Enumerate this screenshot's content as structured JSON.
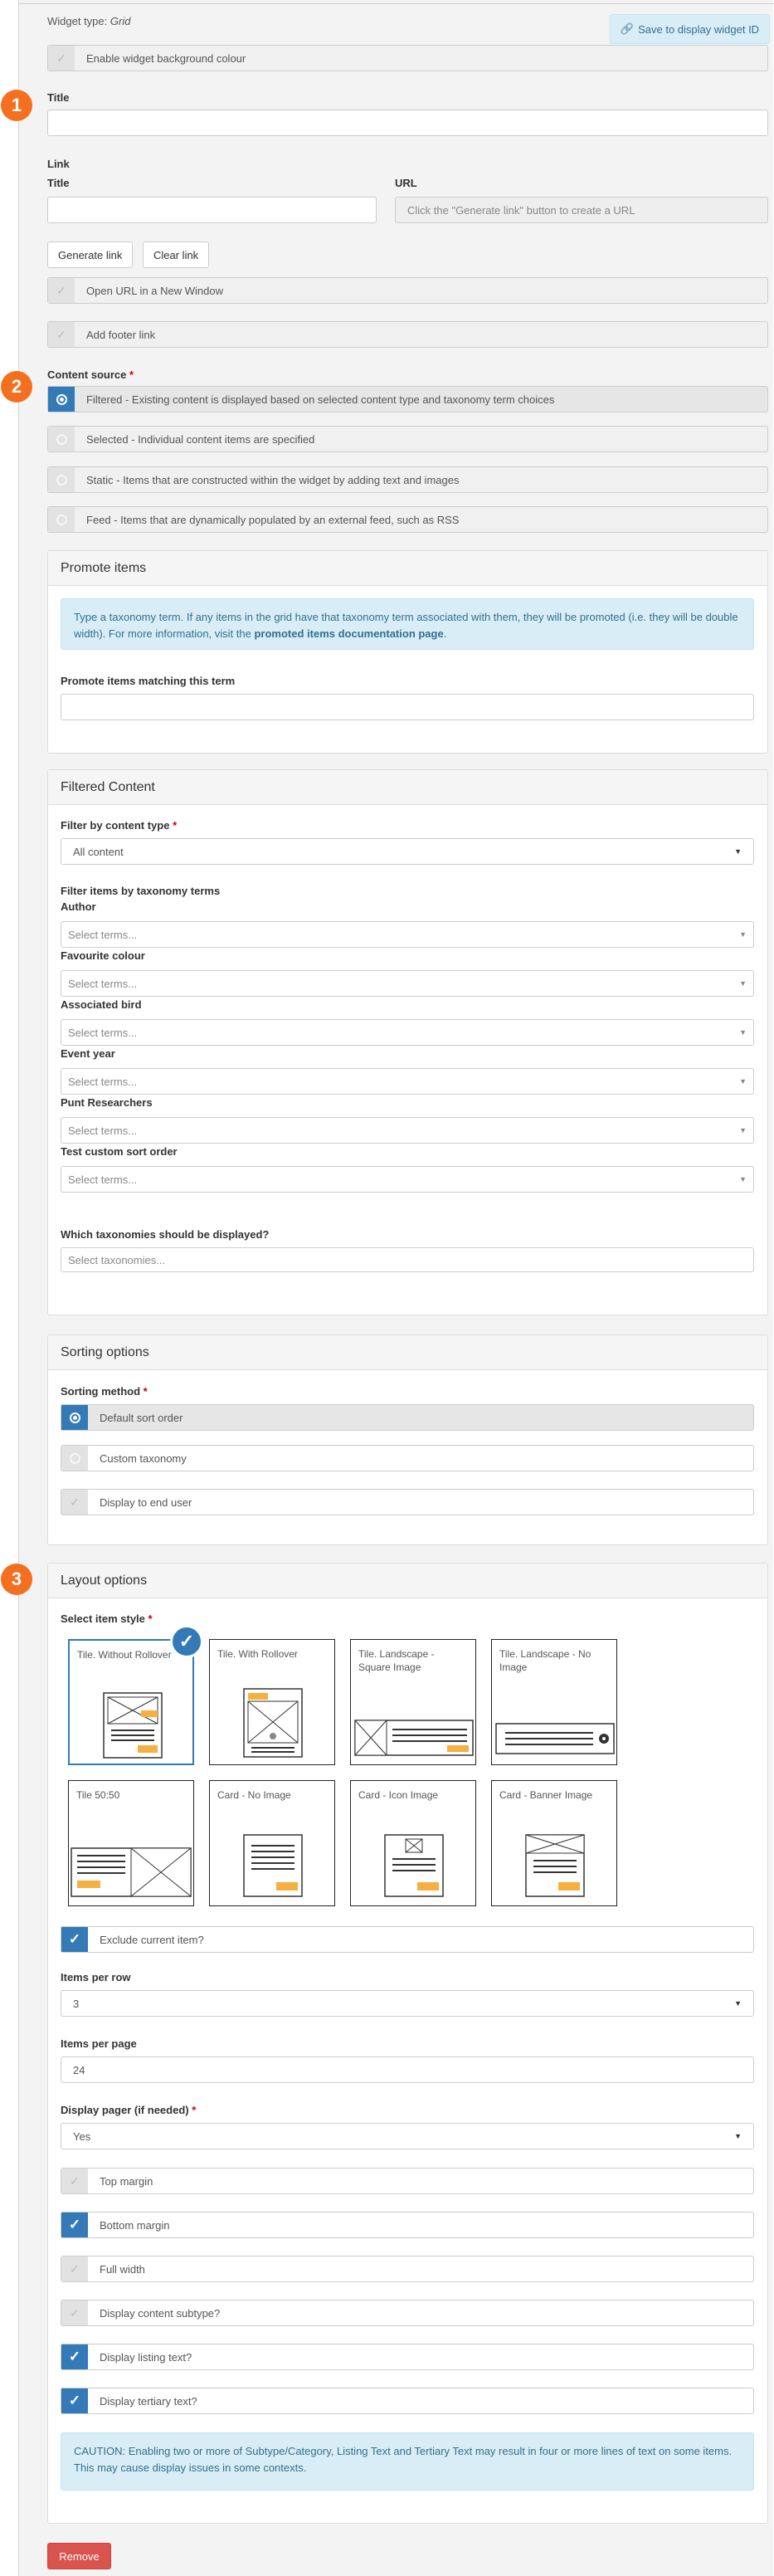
{
  "header": {
    "widget_type_label": "Widget type:",
    "widget_type_value": "Grid",
    "save_button": "Save to display widget ID",
    "enable_bg": "Enable widget background colour"
  },
  "badges": [
    "1",
    "2",
    "3"
  ],
  "title_field": {
    "label": "Title",
    "value": ""
  },
  "link": {
    "section_label": "Link",
    "title_label": "Title",
    "title_value": "",
    "url_label": "URL",
    "url_placeholder": "Click the \"Generate link\" button to create a URL",
    "generate_button": "Generate link",
    "clear_button": "Clear link",
    "open_new_window": "Open URL in a New Window",
    "add_footer_link": "Add footer link"
  },
  "content_source": {
    "label": "Content source",
    "options": [
      "Filtered - Existing content is displayed based on selected content type and taxonomy term choices",
      "Selected - Individual content items are specified",
      "Static - Items that are constructed within the widget by adding text and images",
      "Feed - Items that are dynamically populated by an external feed, such as RSS"
    ]
  },
  "promote": {
    "heading": "Promote items",
    "info_text": "Type a taxonomy term. If any items in the grid have that taxonomy term associated with them, they will be promoted (i.e. they will be double width). For more information, visit the ",
    "info_link": "promoted items documentation page",
    "info_end": ".",
    "field_label": "Promote items matching this term",
    "field_value": ""
  },
  "filtered": {
    "heading": "Filtered Content",
    "content_type_label": "Filter by content type",
    "content_type_value": "All content",
    "taxonomy_label": "Filter items by taxonomy terms",
    "taxonomies": [
      {
        "label": "Author",
        "placeholder": "Select terms..."
      },
      {
        "label": "Favourite colour",
        "placeholder": "Select terms..."
      },
      {
        "label": "Associated bird",
        "placeholder": "Select terms..."
      },
      {
        "label": "Event year",
        "placeholder": "Select terms..."
      },
      {
        "label": "Punt Researchers",
        "placeholder": "Select terms..."
      },
      {
        "label": "Test custom sort order",
        "placeholder": "Select terms..."
      }
    ],
    "display_tax_label": "Which taxonomies should be displayed?",
    "display_tax_placeholder": "Select taxonomies..."
  },
  "sorting": {
    "heading": "Sorting options",
    "method_label": "Sorting method",
    "options": [
      "Default sort order",
      "Custom taxonomy",
      "Display to end user"
    ]
  },
  "layout": {
    "heading": "Layout options",
    "style_label": "Select item style",
    "styles": [
      "Tile. Without Rollover",
      "Tile. With Rollover",
      "Tile. Landscape - Square Image",
      "Tile. Landscape - No Image",
      "Tile 50:50",
      "Card - No Image",
      "Card - Icon Image",
      "Card - Banner Image"
    ],
    "check_mark": "✓",
    "exclude_current": "Exclude current item?",
    "items_per_row_label": "Items per row",
    "items_per_row_value": "3",
    "items_per_page_label": "Items per page",
    "items_per_page_value": "24",
    "pager_label": "Display pager (if needed)",
    "pager_value": "Yes",
    "toggles": [
      {
        "label": "Top margin",
        "on": false
      },
      {
        "label": "Bottom margin",
        "on": true
      },
      {
        "label": "Full width",
        "on": false
      },
      {
        "label": "Display content subtype?",
        "on": false
      },
      {
        "label": "Display listing text?",
        "on": true
      },
      {
        "label": "Display tertiary text?",
        "on": true
      }
    ],
    "caution": "CAUTION: Enabling two or more of Subtype/Category, Listing Text and Tertiary Text may result in four or more lines of text on some items. This may cause display issues in some contexts."
  },
  "footer": {
    "remove_button": "Remove"
  },
  "colors": {
    "accent": "#337ab7",
    "badge": "#f37021",
    "danger": "#d9534f",
    "info_bg": "#d9edf7"
  }
}
